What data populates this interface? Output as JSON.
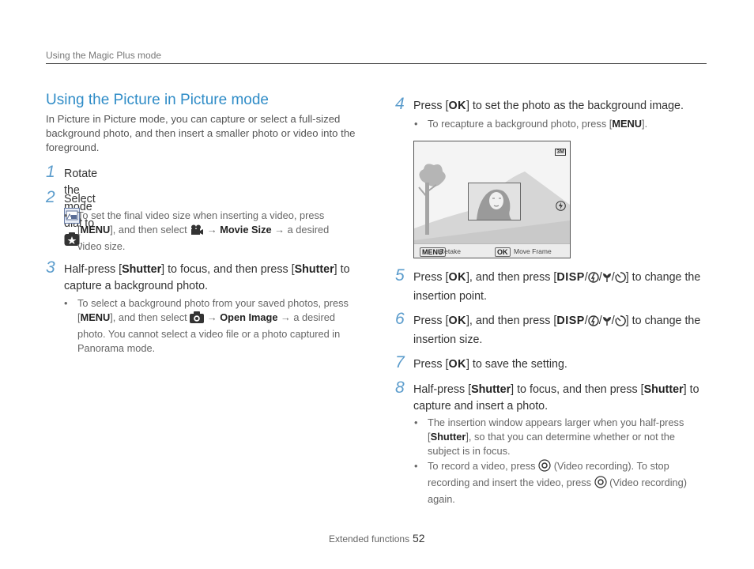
{
  "header": {
    "section": "Using the Magic Plus mode"
  },
  "title": "Using the Picture in Picture mode",
  "intro": "In Picture in Picture mode, you can capture or select a full-sized background photo, and then insert a smaller photo or video into the foreground.",
  "steps": [
    {
      "num": "1",
      "pre": "Rotate the mode dial to",
      "post": "."
    },
    {
      "num": "2",
      "pre": "Select",
      "post": "."
    },
    {
      "num": "3"
    },
    {
      "num": "4",
      "pre": "Press [",
      "post": "] to set the photo as the background image."
    },
    {
      "num": "5",
      "pre": "Press [",
      "mid": "], and then press [",
      "post": "] to change the insertion point."
    },
    {
      "num": "6",
      "pre": "Press [",
      "mid": "], and then press [",
      "post": "] to change the insertion size."
    },
    {
      "num": "7",
      "pre": "Press [",
      "post": "] to save the setting."
    },
    {
      "num": "8"
    }
  ],
  "step2_bullet": {
    "a": "To set the final video size when inserting a video, press [",
    "b": "], and then select",
    "arrow": "→",
    "bold": "Movie Size",
    "c": "a desired video size."
  },
  "step3": {
    "a": "Half-press [",
    "shutter": "Shutter",
    "b": "] to focus, and then press [",
    "c": "] to capture a background photo."
  },
  "step3_bullet": {
    "a": "To select a background photo from your saved photos, press [",
    "b": "], and then select",
    "arrow": "→",
    "bold": "Open Image",
    "c": "a desired photo. You cannot select a video file or a photo captured in Panorama mode."
  },
  "step4_bullet": {
    "a": "To recapture a background photo, press [",
    "b": "]."
  },
  "step8": {
    "a": "Half-press [",
    "shutter": "Shutter",
    "b": "] to focus, and then press [",
    "c": "] to capture and insert a photo."
  },
  "step8_bullets": {
    "b1a": "The insertion window appears larger when you half-press [",
    "b1b": "], so that you can determine whether or not the subject is in focus.",
    "b2a": "To record a video, press",
    "b2b": "(Video recording). To stop recording and insert the video, press",
    "b2c": "(Video recording) again."
  },
  "keys": {
    "menu": "MENU",
    "ok": "OK",
    "disp": "DISP",
    "sep": "/",
    "bullet": "•"
  },
  "camera_screen": {
    "menu_key": "MENU",
    "menu_label": "Retake",
    "ok_key": "OK",
    "ok_label": "Move Frame",
    "size_badge": "3M"
  },
  "footer": {
    "label": "Extended functions",
    "page": "52"
  }
}
